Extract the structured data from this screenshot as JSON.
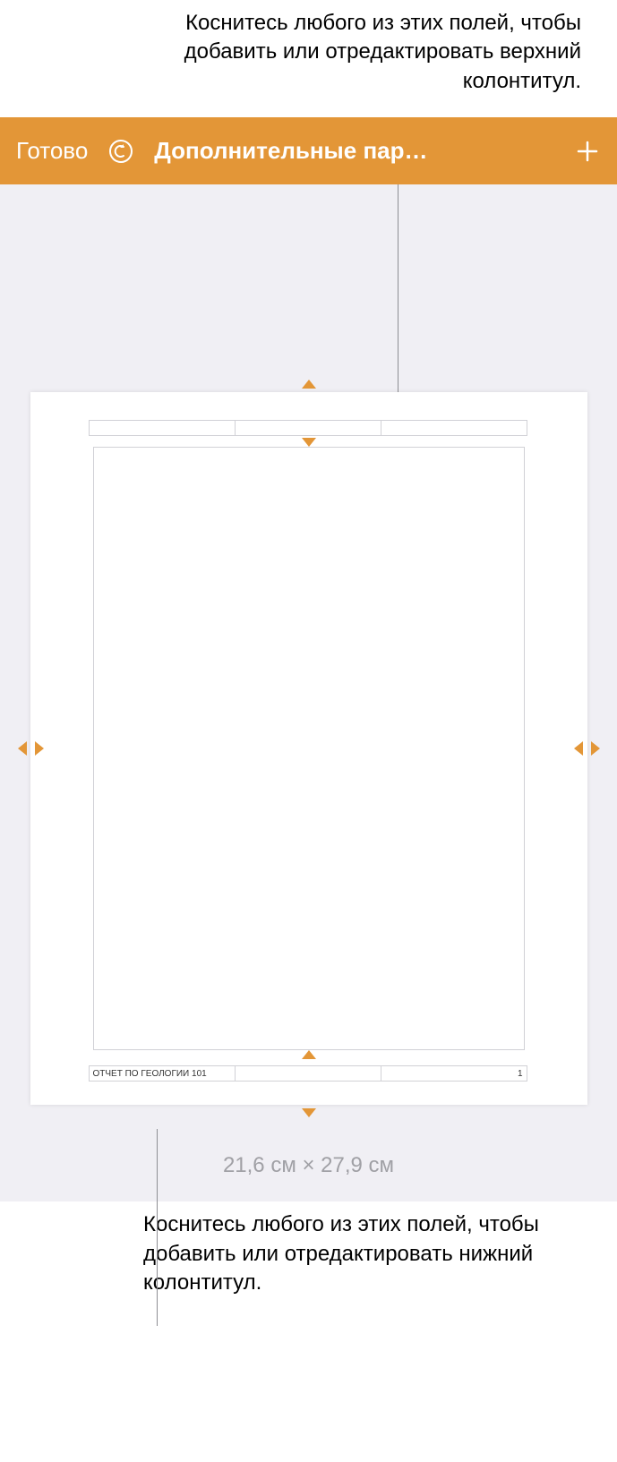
{
  "callouts": {
    "top": "Коснитесь любого из этих полей, чтобы добавить или отредактировать верхний колонтитул.",
    "bottom": "Коснитесь любого из этих полей, чтобы добавить или отредактировать нижний колонтитул."
  },
  "toolbar": {
    "done_label": "Готово",
    "title": "Дополнительные пар…",
    "undo_icon": "undo",
    "add_icon": "plus"
  },
  "page": {
    "header": {
      "left": "",
      "center": "",
      "right": ""
    },
    "footer": {
      "left": "ОТЧЕТ ПО ГЕОЛОГИИ 101",
      "center": "",
      "right": "1"
    },
    "dimensions": "21,6 см × 27,9 см"
  },
  "colors": {
    "accent": "#e39637",
    "canvas": "#f0eff4"
  }
}
